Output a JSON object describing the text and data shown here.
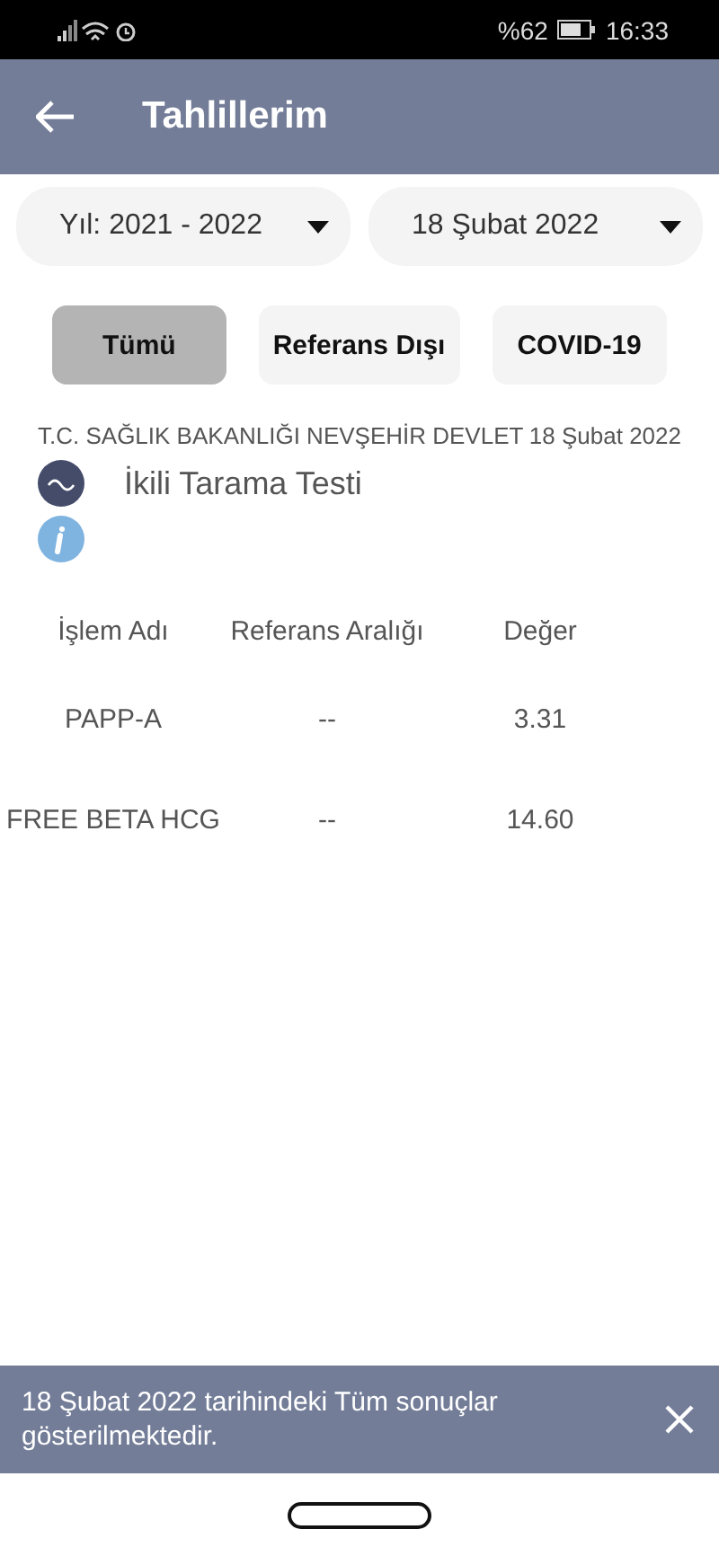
{
  "status_bar": {
    "battery_percent": "%62",
    "time": "16:33"
  },
  "header": {
    "title": "Tahlillerim"
  },
  "dropdowns": [
    {
      "value": "Yıl: 2021 - 2022"
    },
    {
      "value": "18 Şubat 2022"
    }
  ],
  "filters": [
    {
      "label": "Tümü",
      "selected": true
    },
    {
      "label": "Referans Dışı",
      "selected": false
    },
    {
      "label": "COVID-19",
      "selected": false
    }
  ],
  "result": {
    "institution": "T.C. SAĞLIK BAKANLIĞI NEVŞEHİR DEVLET",
    "date": "18 Şubat 2022",
    "test_name": "İkili Tarama Testi"
  },
  "table": {
    "columns": [
      "İşlem Adı",
      "Referans Aralığı",
      "Değer"
    ],
    "rows": [
      [
        "PAPP-A",
        "--",
        "3.31"
      ],
      [
        "FREE BETA HCG",
        "--",
        "14.60"
      ]
    ]
  },
  "snackbar": {
    "message": "18 Şubat 2022 tarihindeki Tüm sonuçlar gösterilmektedir."
  }
}
